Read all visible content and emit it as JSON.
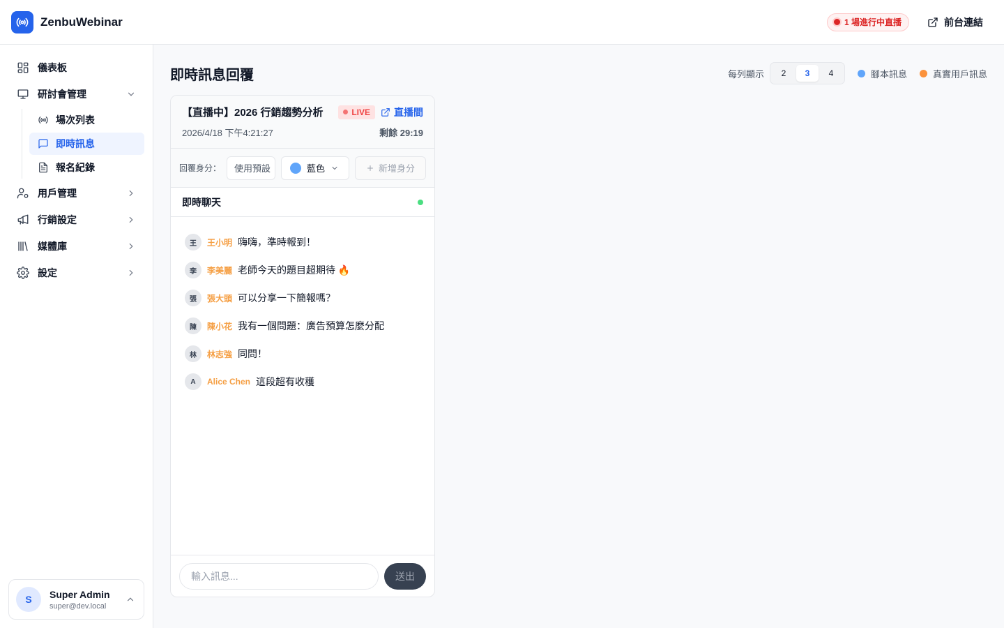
{
  "app": {
    "name": "ZenbuWebinar"
  },
  "topbar": {
    "live_count": "1 場進行中直播",
    "front_link": "前台連結"
  },
  "sidebar": {
    "items": [
      {
        "label": "儀表板"
      },
      {
        "label": "研討會管理"
      },
      {
        "label": "用戶管理"
      },
      {
        "label": "行銷設定"
      },
      {
        "label": "媒體庫"
      },
      {
        "label": "設定"
      }
    ],
    "sub_items": [
      {
        "label": "場次列表"
      },
      {
        "label": "即時訊息"
      },
      {
        "label": "報名紀錄"
      }
    ],
    "user": {
      "initial": "S",
      "name": "Super Admin",
      "email": "super@dev.local"
    }
  },
  "main": {
    "title": "即時訊息回覆",
    "per_row_label": "每列顯示",
    "per_row_options": [
      "2",
      "3",
      "4"
    ],
    "per_row_selected": "3",
    "legend": [
      {
        "label": "腳本訊息",
        "color": "#60a5fa"
      },
      {
        "label": "真實用戶訊息",
        "color": "#fb923c"
      }
    ]
  },
  "card": {
    "title": "【直播中】2026 行銷趨勢分析",
    "live_badge": "LIVE",
    "room_link": "直播間",
    "datetime": "2026/4/18 下午4:21:27",
    "remaining": "剩餘 29:19",
    "reply_label": "回覆身分：",
    "preset": "使用預設",
    "color_label": "藍色",
    "add_identity": "新增身分",
    "chat_title": "即時聊天",
    "messages": [
      {
        "initial": "王",
        "name": "王小明",
        "text": "嗨嗨，準時報到！"
      },
      {
        "initial": "李",
        "name": "李美麗",
        "text": "老師今天的題目超期待 🔥"
      },
      {
        "initial": "張",
        "name": "張大頭",
        "text": "可以分享一下簡報嗎？"
      },
      {
        "initial": "陳",
        "name": "陳小花",
        "text": "我有一個問題：廣告預算怎麼分配"
      },
      {
        "initial": "林",
        "name": "林志強",
        "text": "同問！"
      },
      {
        "initial": "A",
        "name": "Alice Chen",
        "text": "這段超有收穫"
      }
    ],
    "input_placeholder": "輸入訊息...",
    "send_label": "送出"
  }
}
